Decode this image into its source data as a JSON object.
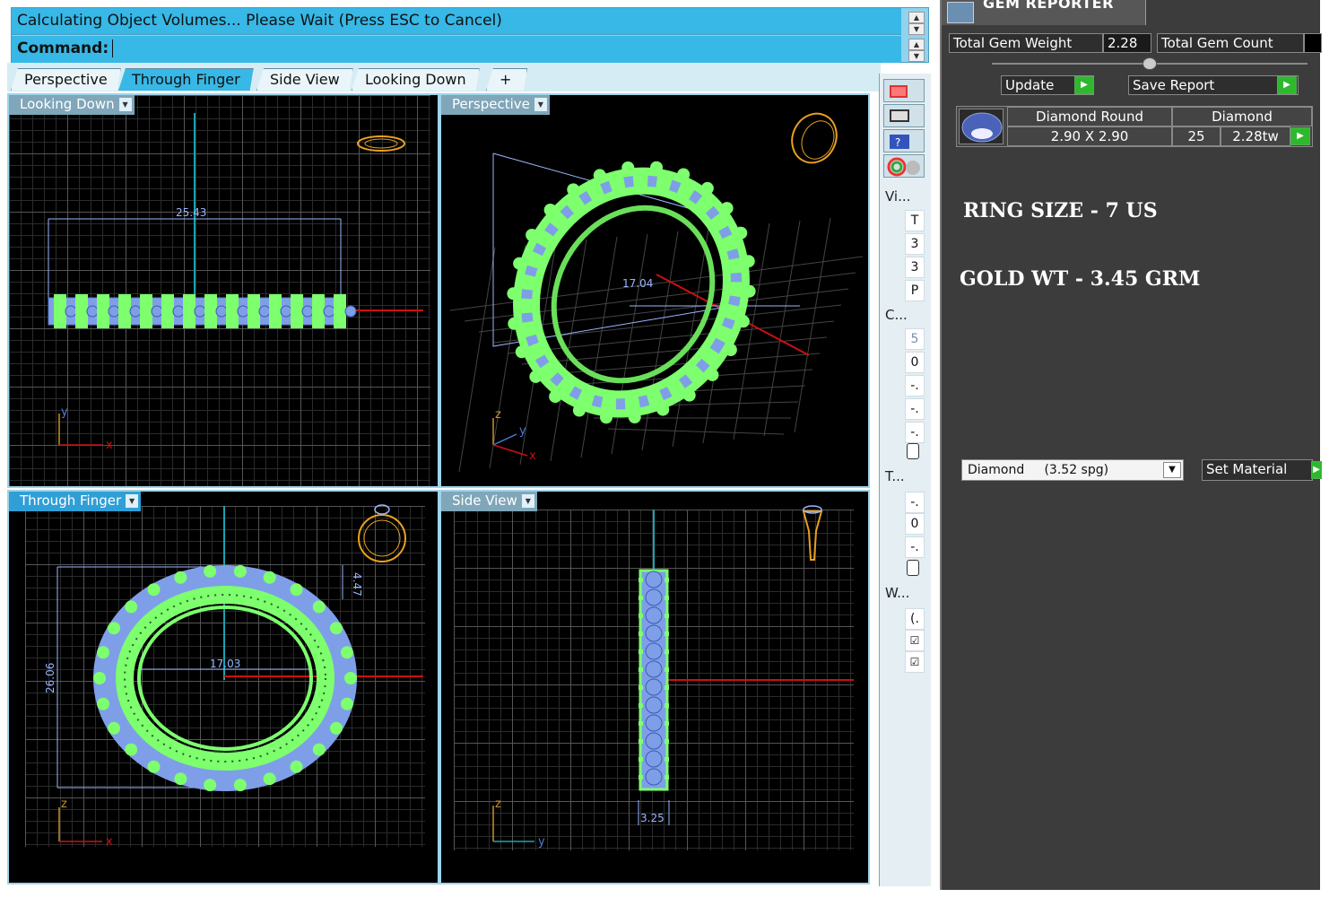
{
  "command_area": {
    "status": "Calculating Object Volumes... Please Wait (Press ESC to Cancel)",
    "command_label": "Command:"
  },
  "tabs": [
    {
      "label": "Perspective",
      "active": false
    },
    {
      "label": "Through Finger",
      "active": true
    },
    {
      "label": "Side View",
      "active": false
    },
    {
      "label": "Looking Down",
      "active": false
    },
    {
      "label": "+",
      "active": false
    }
  ],
  "viewports": {
    "looking_down": {
      "label": "Looking Down",
      "dimension": "25.43",
      "axis_x": "x",
      "axis_y": "y"
    },
    "perspective": {
      "label": "Perspective",
      "dimension": "17.04",
      "axis_x": "x",
      "axis_y": "y",
      "axis_z": "z"
    },
    "through_finger": {
      "label": "Through Finger",
      "dimension_width": "17.03",
      "dimension_height": "26.06",
      "dimension_band": "4.47",
      "axis_x": "x",
      "axis_z": "z"
    },
    "side_view": {
      "label": "Side View",
      "dimension": "3.25",
      "axis_y": "y",
      "axis_z": "z"
    }
  },
  "side_panel": {
    "section_1": "Vi...",
    "items_1": [
      "T",
      "3",
      "3",
      "P"
    ],
    "section_2": "C...",
    "items_2": [
      "5",
      "0",
      "-.",
      "-.",
      "-."
    ],
    "section_3": "T...",
    "items_3": [
      "-.",
      "0",
      "-."
    ],
    "section_4": "W...",
    "items_4": [
      "(.",
      "☑",
      "☑"
    ]
  },
  "gem_reporter": {
    "title": "GEM REPORTER",
    "total_weight_label": "Total Gem Weight",
    "total_weight_value": "2.28",
    "total_count_label": "Total Gem Count",
    "update_label": "Update",
    "save_report_label": "Save Report",
    "gem": {
      "shape": "Diamond Round",
      "material": "Diamond",
      "size": "2.90 X 2.90",
      "count": "25",
      "weight": "2.28tw"
    },
    "note_ring_size": "RING SIZE - 7 US",
    "note_gold_wt": "GOLD WT - 3.45 GRM",
    "material_select": "Diamond     (3.52 spg)",
    "set_material_label": "Set Material"
  },
  "colors": {
    "accent": "#37b8e6",
    "gem_blue": "#7f9ee8",
    "prong_green": "#7dff6e",
    "axis_red": "#cc1010",
    "axis_teal": "#1aa3b0",
    "dim_line": "#9ab6ff",
    "go_green": "#2eb82e"
  }
}
